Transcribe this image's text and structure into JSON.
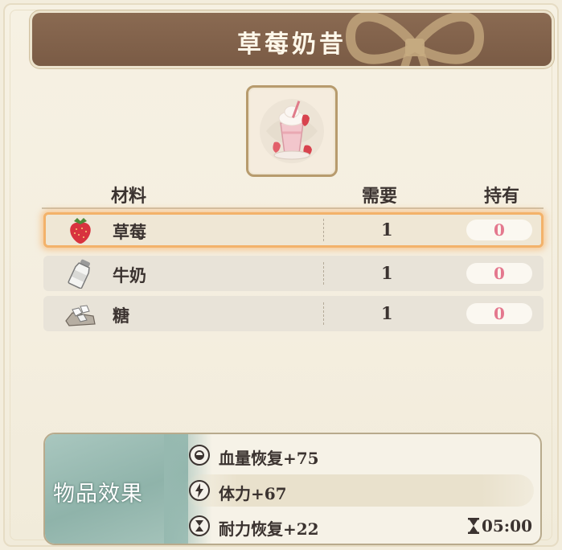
{
  "title": "草莓奶昔",
  "item_image": {
    "icon": "strawberry-milkshake-icon"
  },
  "table": {
    "headers": {
      "material": "材料",
      "need": "需要",
      "have": "持有"
    },
    "rows": [
      {
        "name": "草莓",
        "need": "1",
        "have": "0",
        "icon": "strawberry-icon",
        "selected": true
      },
      {
        "name": "牛奶",
        "need": "1",
        "have": "0",
        "icon": "milk-bottle-icon",
        "selected": false
      },
      {
        "name": "糖",
        "need": "1",
        "have": "0",
        "icon": "sugar-cubes-icon",
        "selected": false
      }
    ]
  },
  "effects": {
    "label": "物品效果",
    "items": [
      {
        "text": "血量恢复+75",
        "icon": "health-icon"
      },
      {
        "text": "体力+67",
        "icon": "lightning-icon"
      },
      {
        "text": "耐力恢复+22",
        "icon": "hourglass-icon",
        "timer": "05:00",
        "timer_icon": "hourglass-icon"
      }
    ]
  },
  "colors": {
    "banner": "#7a5b45",
    "selected_glow": "#f3b26a",
    "have_count": "#e4788e",
    "effects_label_bg": "#8fb3aa"
  }
}
